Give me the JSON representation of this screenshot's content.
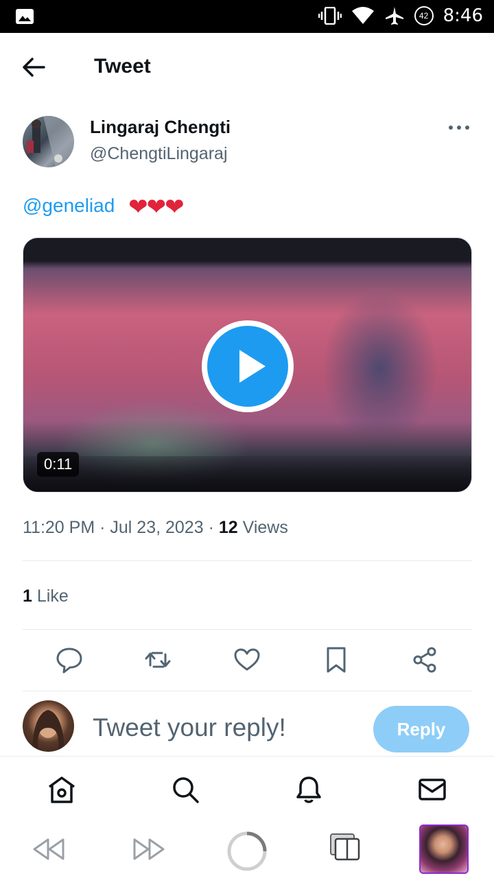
{
  "status_bar": {
    "time": "8:46",
    "battery": "42"
  },
  "header": {
    "title": "Tweet"
  },
  "tweet": {
    "author_name": "Lingaraj Chengti",
    "author_handle": "@ChengtiLingaraj",
    "mention": "@geneliad",
    "hearts": "❤❤❤",
    "video_duration": "0:11",
    "time": "11:20 PM",
    "date": "Jul 23, 2023",
    "views_count": "12",
    "views_label": "Views",
    "likes_count": "1",
    "likes_label": "Like"
  },
  "reply": {
    "placeholder": "Tweet your reply!",
    "button_label": "Reply"
  },
  "colors": {
    "accent": "#1d9bf0",
    "reply_button": "#8ecdf7",
    "heart": "#e0243b",
    "secondary_text": "#536471"
  },
  "icons": {
    "actions": [
      "reply-icon",
      "retweet-icon",
      "like-icon",
      "bookmark-icon",
      "share-icon"
    ],
    "bottom_nav": [
      "home-icon",
      "search-icon",
      "notifications-icon",
      "messages-icon"
    ],
    "system": [
      "rewind-icon",
      "fast-forward-icon",
      "loading-icon",
      "tabs-icon"
    ]
  }
}
